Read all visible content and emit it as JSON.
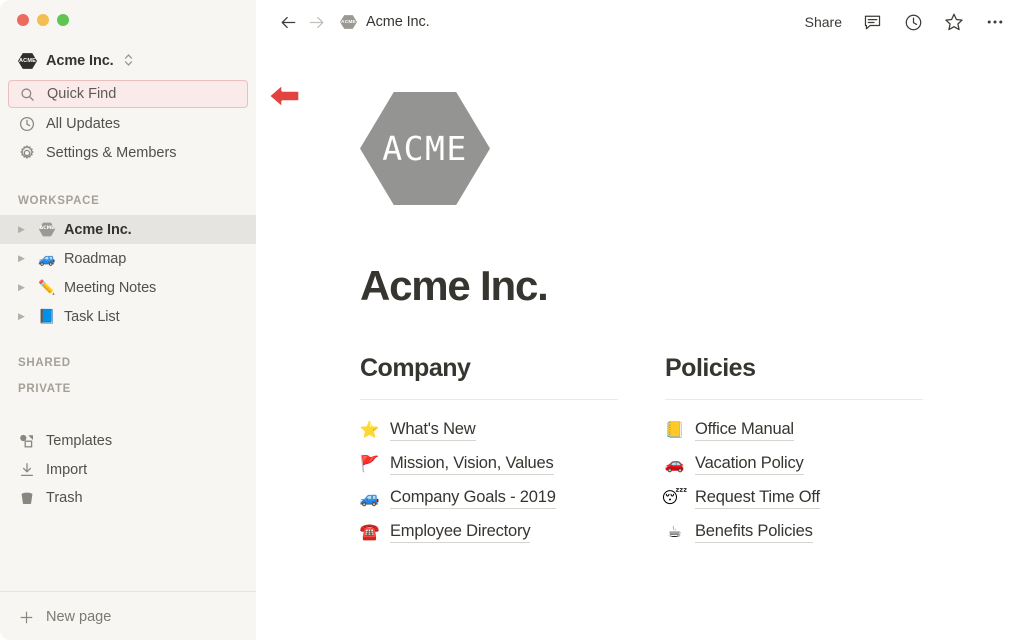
{
  "window": {
    "traffic_lights": [
      "close",
      "minimize",
      "zoom"
    ]
  },
  "sidebar": {
    "workspace_switcher": {
      "badge_text": "ACME",
      "name": "Acme Inc.",
      "chevron": "⌃⌄"
    },
    "nav": [
      {
        "id": "quick-find",
        "label": "Quick Find",
        "icon": "search-icon",
        "highlighted": true
      },
      {
        "id": "all-updates",
        "label": "All Updates",
        "icon": "clock-icon",
        "highlighted": false
      },
      {
        "id": "settings-members",
        "label": "Settings & Members",
        "icon": "gear-icon",
        "highlighted": false
      }
    ],
    "sections": {
      "workspace_label": "WORKSPACE",
      "shared_label": "SHARED",
      "private_label": "PRIVATE"
    },
    "workspace_pages": [
      {
        "label": "Acme Inc.",
        "emoji": "",
        "badge_text": "ACME",
        "selected": true
      },
      {
        "label": "Roadmap",
        "emoji": "🚙",
        "selected": false
      },
      {
        "label": "Meeting Notes",
        "emoji": "✏️",
        "selected": false
      },
      {
        "label": "Task List",
        "emoji": "📘",
        "selected": false
      }
    ],
    "utility": [
      {
        "id": "templates",
        "label": "Templates",
        "icon": "templates-icon"
      },
      {
        "id": "import",
        "label": "Import",
        "icon": "import-download-icon"
      },
      {
        "id": "trash",
        "label": "Trash",
        "icon": "trash-icon"
      }
    ],
    "new_page": {
      "label": "New page",
      "icon": "plus-icon"
    }
  },
  "topbar": {
    "back_icon": "arrow-left-icon",
    "forward_icon": "arrow-right-icon",
    "breadcrumb": {
      "badge_text": "ACME",
      "label": "Acme Inc."
    },
    "share_label": "Share",
    "icons": [
      "comment-icon",
      "history-clock-icon",
      "star-icon",
      "more-options-icon"
    ]
  },
  "main": {
    "logo": {
      "text": "ACME",
      "shape": "hexagon",
      "color": "#949492"
    },
    "title": "Acme Inc.",
    "columns": [
      {
        "heading": "Company",
        "links": [
          {
            "emoji": "⭐",
            "label": "What's New"
          },
          {
            "emoji": "🚩",
            "label": "Mission, Vision, Values"
          },
          {
            "emoji": "🚙",
            "label": "Company Goals - 2019"
          },
          {
            "emoji": "☎️",
            "label": "Employee Directory"
          }
        ]
      },
      {
        "heading": "Policies",
        "links": [
          {
            "emoji": "📒",
            "label": "Office Manual"
          },
          {
            "emoji": "🚗",
            "label": "Vacation Policy"
          },
          {
            "emoji": "😴",
            "label": "Request Time Off"
          },
          {
            "emoji": "☕",
            "label": "Benefits Policies"
          }
        ]
      }
    ]
  },
  "annotation": {
    "arrow": {
      "direction": "left",
      "color": "#e3433f",
      "target": "quick-find"
    }
  },
  "colors": {
    "sidebar_bg": "#f7f6f3",
    "content_bg": "#ffffff",
    "text_primary": "#37352f",
    "highlight_fill": "#fbeaea",
    "highlight_border": "#e9bfbf",
    "selected_row": "#e5e4e0",
    "accent_red": "#e3433f"
  }
}
